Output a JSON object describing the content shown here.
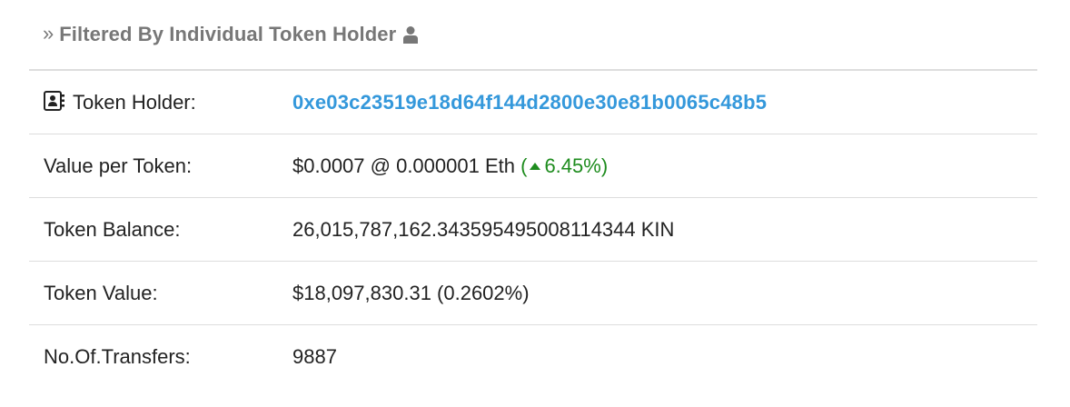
{
  "header": {
    "chevron": "»",
    "title": "Filtered By Individual Token Holder",
    "icon": "user-icon"
  },
  "rows": [
    {
      "label": "Token Holder:",
      "icon": "contact-card-icon",
      "value": "0xe03c23519e18d64f144d2800e30e81b0065c48b5"
    },
    {
      "label": "Value per Token:",
      "value": "$0.0007 @ 0.000001 Eth",
      "change_open": "(",
      "change_value": "6.45%)",
      "change_direction": "up"
    },
    {
      "label": "Token Balance:",
      "value": "26,015,787,162.343595495008114344 KIN"
    },
    {
      "label": "Token Value:",
      "value": "$18,097,830.31 (0.2602%)"
    },
    {
      "label": "No.Of.Transfers:",
      "value": "9887"
    }
  ],
  "colors": {
    "link": "#3498db",
    "positive": "#1e8c1e",
    "header_text": "#777777",
    "divider": "#dddddd"
  }
}
